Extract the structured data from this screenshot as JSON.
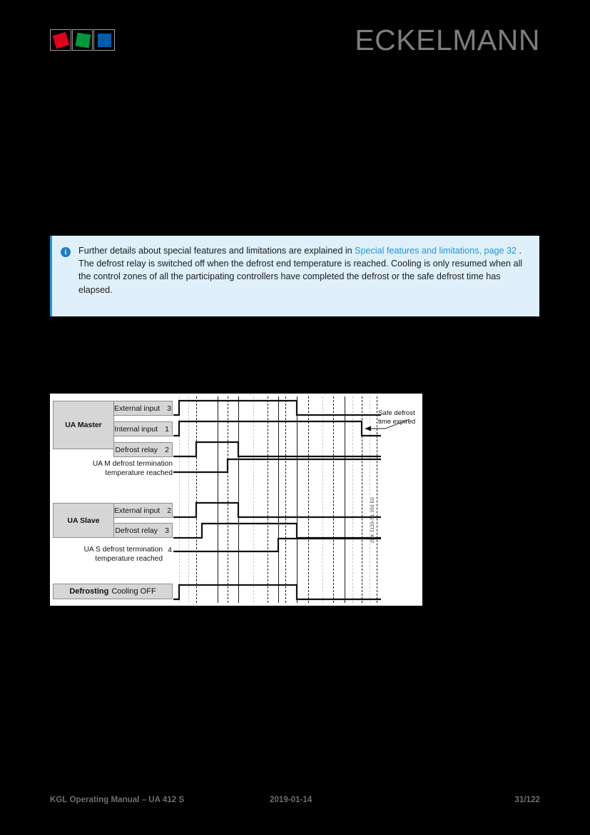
{
  "header": {
    "brand": "ECKELMANN",
    "logo_cells": [
      {
        "name": "logo-square-red",
        "color": "#e2001a"
      },
      {
        "name": "logo-square-green",
        "color": "#00983a"
      },
      {
        "name": "logo-square-blue",
        "color": "#005ca9"
      }
    ]
  },
  "info_box": {
    "icon": "info-icon",
    "accent_color": "#1b9ad6",
    "background_color": "#dff0fb",
    "text_before_link": "Further details about special features and limitations are explained in ",
    "link_text": "Special features and limitations",
    "link_page_text": ", page 32",
    "text_after_link": " .",
    "paragraph2": "The defrost relay is switched off when the defrost end temperature is reached. Cooling is only resumed when all the control zones of all the participating controllers have completed the defrost or the safe defrost time has elapsed."
  },
  "diagram": {
    "side_code": "2HK 5120-S1 350 E0",
    "annotation": {
      "line1": "Safe defrost",
      "line2": "time expired"
    },
    "master": {
      "group_label": "UA Master",
      "signals": [
        {
          "label": "External input",
          "number": "3"
        },
        {
          "label": "Internal input",
          "number": "1"
        },
        {
          "label": "Defrost relay",
          "number": "2"
        }
      ],
      "note_line1": "UA M defrost termination",
      "note_line2": "temperature reached"
    },
    "slave": {
      "group_label": "UA Slave",
      "signals": [
        {
          "label": "External input",
          "number": "2"
        },
        {
          "label": "Defrost relay",
          "number": "3"
        }
      ],
      "note_line1": "UA S defrost termination",
      "note_line2": "temperature reached",
      "note_number": "4"
    },
    "defrost_bar": {
      "bold_label": "Defrosting",
      "label": "Cooling OFF"
    }
  },
  "footer": {
    "left": "KGL Operating Manual – UA 412 S",
    "middle": "2019-01-14",
    "right": "31/122"
  }
}
